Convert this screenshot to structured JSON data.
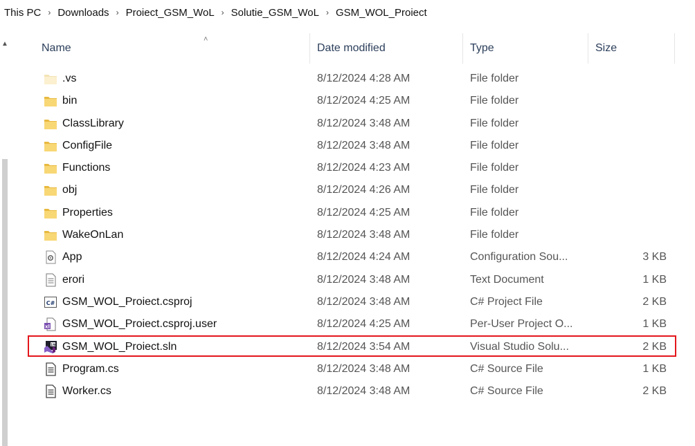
{
  "breadcrumb": [
    "This PC",
    "Downloads",
    "Proiect_GSM_WoL",
    "Solutie_GSM_WoL",
    "GSM_WOL_Proiect"
  ],
  "columns": {
    "name": "Name",
    "date": "Date modified",
    "type": "Type",
    "size": "Size"
  },
  "files": [
    {
      "name": ".vs",
      "date": "8/12/2024 4:28 AM",
      "type": "File folder",
      "size": "",
      "icon": "folder-faded-icon"
    },
    {
      "name": "bin",
      "date": "8/12/2024 4:25 AM",
      "type": "File folder",
      "size": "",
      "icon": "folder-icon"
    },
    {
      "name": "ClassLibrary",
      "date": "8/12/2024 3:48 AM",
      "type": "File folder",
      "size": "",
      "icon": "folder-icon"
    },
    {
      "name": "ConfigFile",
      "date": "8/12/2024 3:48 AM",
      "type": "File folder",
      "size": "",
      "icon": "folder-icon"
    },
    {
      "name": "Functions",
      "date": "8/12/2024 4:23 AM",
      "type": "File folder",
      "size": "",
      "icon": "folder-icon"
    },
    {
      "name": "obj",
      "date": "8/12/2024 4:26 AM",
      "type": "File folder",
      "size": "",
      "icon": "folder-icon"
    },
    {
      "name": "Properties",
      "date": "8/12/2024 4:25 AM",
      "type": "File folder",
      "size": "",
      "icon": "folder-icon"
    },
    {
      "name": "WakeOnLan",
      "date": "8/12/2024 3:48 AM",
      "type": "File folder",
      "size": "",
      "icon": "folder-icon"
    },
    {
      "name": "App",
      "date": "8/12/2024 4:24 AM",
      "type": "Configuration Sou...",
      "size": "3 KB",
      "icon": "config-file-icon"
    },
    {
      "name": "erori",
      "date": "8/12/2024 3:48 AM",
      "type": "Text Document",
      "size": "1 KB",
      "icon": "text-document-icon"
    },
    {
      "name": "GSM_WOL_Proiect.csproj",
      "date": "8/12/2024 3:48 AM",
      "type": "C# Project File",
      "size": "2 KB",
      "icon": "csharp-project-icon"
    },
    {
      "name": "GSM_WOL_Proiect.csproj.user",
      "date": "8/12/2024 4:25 AM",
      "type": "Per-User Project O...",
      "size": "1 KB",
      "icon": "user-project-file-icon"
    },
    {
      "name": "GSM_WOL_Proiect.sln",
      "date": "8/12/2024 3:54 AM",
      "type": "Visual Studio Solu...",
      "size": "2 KB",
      "icon": "visual-studio-solution-icon"
    },
    {
      "name": "Program.cs",
      "date": "8/12/2024 3:48 AM",
      "type": "C# Source File",
      "size": "1 KB",
      "icon": "csharp-source-icon"
    },
    {
      "name": "Worker.cs",
      "date": "8/12/2024 3:48 AM",
      "type": "C# Source File",
      "size": "2 KB",
      "icon": "csharp-source-icon"
    }
  ],
  "colors": {
    "folder": "#f8d775",
    "folder_dark": "#e8b93f",
    "highlight": "#e3161b",
    "header_text": "#2b3e5a"
  }
}
